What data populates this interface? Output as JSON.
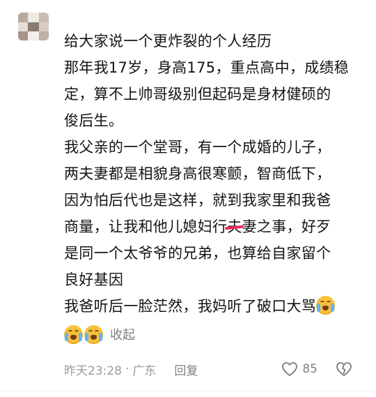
{
  "comment": {
    "paragraphs": [
      {
        "lines": [
          "给大家说一个更炸裂的个人经历"
        ]
      },
      {
        "lines": [
          "那年我17岁，身高175，重点高中，成绩稳",
          "定，算不上帅哥级别但起码是身材健硕的",
          "俊后生。"
        ]
      },
      {
        "lines": [
          "我父亲的一个堂哥，有一个成婚的儿子，",
          "两夫妻都是相貌身高很寒颤，智商低下，",
          "因为怕后代也是这样，就到我家里和我爸"
        ]
      },
      {
        "line_a_before": "商量，让我和他儿媳妇行",
        "line_a_struck": "夫",
        "line_a_after": "妻之事，好歹"
      },
      {
        "lines": [
          "是同一个太爷爷的兄弟，也算给自家留个",
          "良好基因"
        ]
      },
      {
        "last_line": "我爸听后一脸茫然，我妈听了破口大骂"
      }
    ],
    "collapse_label": "收起"
  },
  "meta": {
    "time": "昨天23:28",
    "separator": "·",
    "location": "广东",
    "reply_label": "回复",
    "like_count": "85"
  },
  "icons": {
    "emoji": "loudly-crying-face-icon",
    "like": "heart-outline-icon",
    "dislike": "broken-heart-outline-icon"
  },
  "colors": {
    "strike": "#ee2a55",
    "meta_text": "#9a9a9a"
  }
}
